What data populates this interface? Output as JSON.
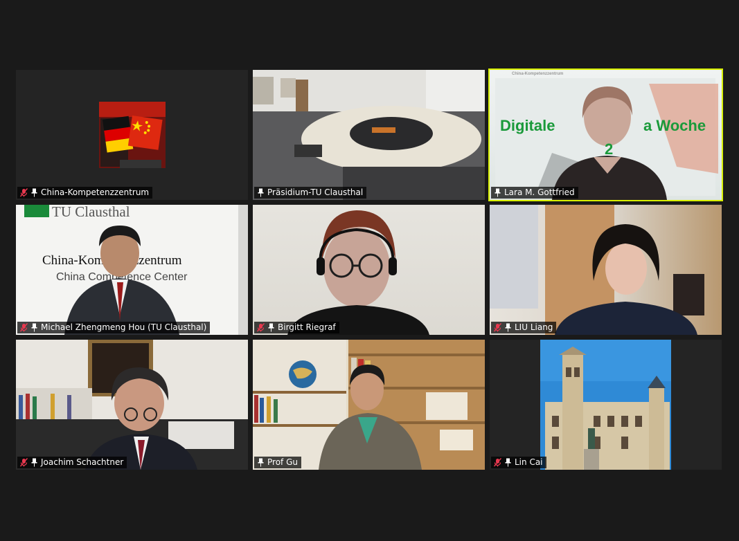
{
  "participants": [
    {
      "name": "China-Kompetenzzentrum",
      "muted": true,
      "pinned": true
    },
    {
      "name": "Präsidium-TU Clausthal",
      "muted": false,
      "pinned": true
    },
    {
      "name": "Lara M. Gottfried",
      "muted": false,
      "pinned": true,
      "active_speaker": true
    },
    {
      "name": "Michael Zhengmeng Hou (TU Clausthal)",
      "muted": true,
      "pinned": true
    },
    {
      "name": "Birgitt Riegraf",
      "muted": true,
      "pinned": true
    },
    {
      "name": "LIU Liang",
      "muted": true,
      "pinned": true
    },
    {
      "name": "Joachim Schachtner",
      "muted": true,
      "pinned": true
    },
    {
      "name": "Prof Gu",
      "muted": false,
      "pinned": true
    },
    {
      "name": "Lin Cai",
      "muted": true,
      "pinned": true
    }
  ],
  "slide": {
    "header": "China-Kompetenzzentrum",
    "title_left": "Digitale",
    "title_right": "a Woche",
    "year": "2"
  },
  "backdrop": {
    "logo_text": "TU Clausthal",
    "center_de": "China-Kompetenzzentrum",
    "center_en": "China Competence Center"
  },
  "colors": {
    "active_border": "#d8f000",
    "muted_icon": "#e8384f",
    "slide_green": "#1a9a3a"
  }
}
